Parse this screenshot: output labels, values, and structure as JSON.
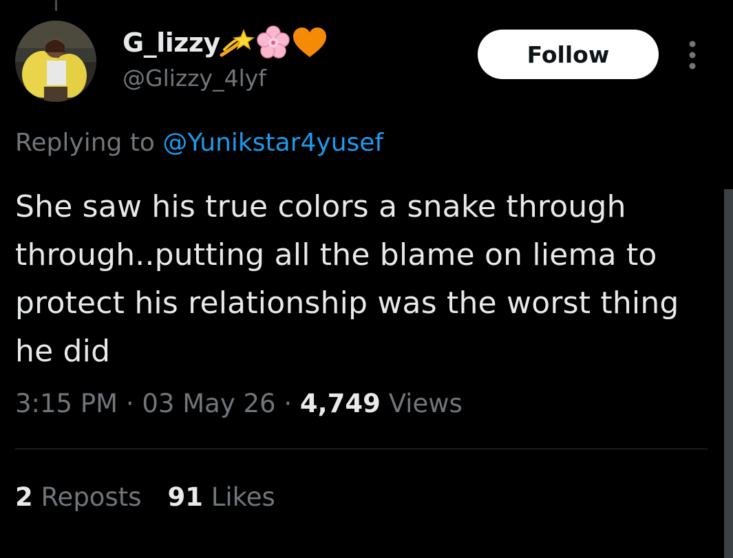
{
  "author": {
    "display_name": "G_lizzy",
    "emojis": [
      "dizzy-star-emoji",
      "cherry-blossom-emoji",
      "orange-heart-emoji"
    ],
    "handle": "@Glizzy_4lyf"
  },
  "follow_label": "Follow",
  "reply_prefix": "Replying to",
  "reply_mention": "@Yunikstar4yusef",
  "tweet_text": "She saw his true colors a snake through through..putting all the blame on liema to protect his relationship was the worst thing he did",
  "meta": {
    "time": "3:15 PM",
    "date": "03 May 26",
    "views_count": "4,749",
    "views_label": "Views",
    "sep": "·"
  },
  "stats": {
    "reposts_count": "2",
    "reposts_label": "Reposts",
    "likes_count": "91",
    "likes_label": "Likes"
  },
  "colors": {
    "background": "#000000",
    "text": "#e7e9ea",
    "secondary": "#71767b",
    "link": "#1d9bf0",
    "follow_bg": "#ffffff"
  }
}
